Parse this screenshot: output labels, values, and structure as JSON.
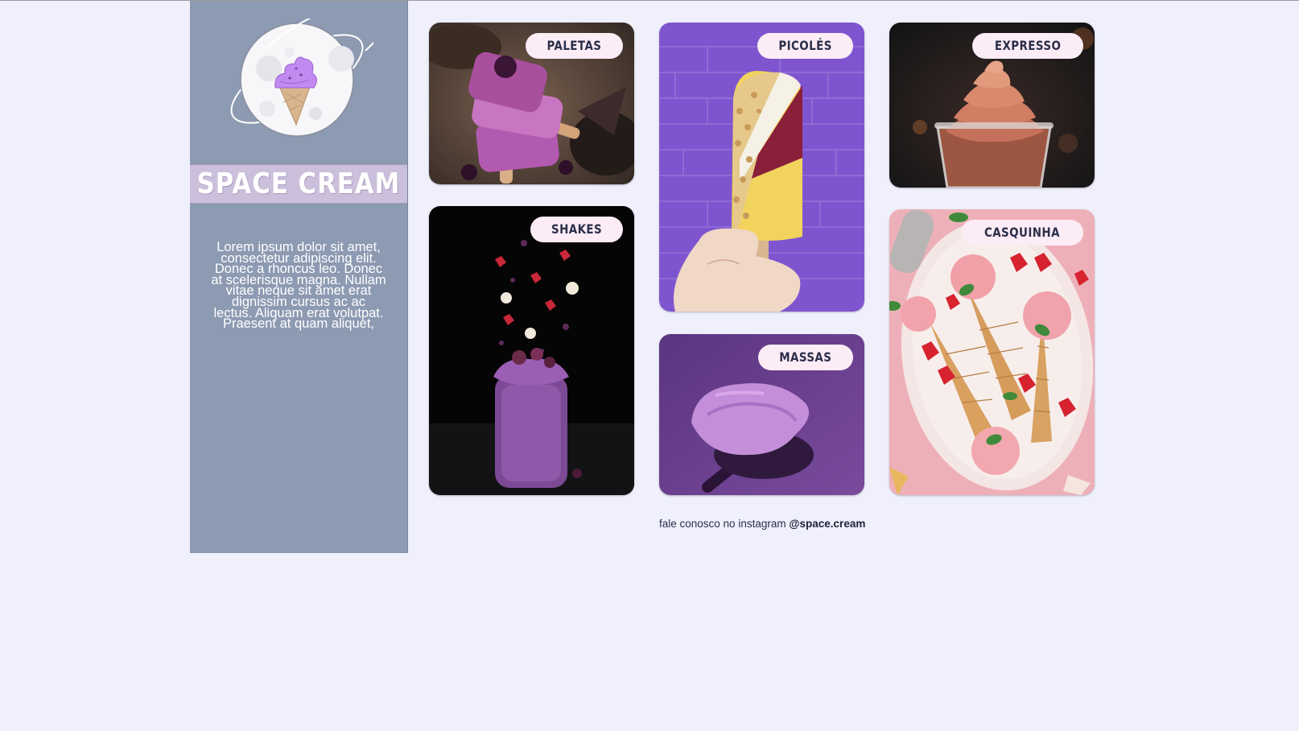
{
  "brand": {
    "name": "SPACE CREAM",
    "description": "Lorem ipsum dolor sit amet, consectetur adipiscing elit. Donec a rhoncus leo. Donec at scelerisque magna. Nullam vitae neque sit amet erat dignissim cursus ac ac lectus. Aliquam erat volutpat. Praesent at quam aliquet,"
  },
  "categories": [
    {
      "label": "PALETAS"
    },
    {
      "label": "PICOLÉS"
    },
    {
      "label": "EXPRESSO"
    },
    {
      "label": "SHAKES"
    },
    {
      "label": "MASSAS"
    },
    {
      "label": "CASQUINHA"
    }
  ],
  "footer": {
    "text": "fale conosco no instagram",
    "handle": "@space.cream"
  },
  "colors": {
    "background": "#eff0fc",
    "sidebar": "#8c9ab2",
    "brand_band": "#cbbfdc",
    "pill": "#fcecf6",
    "pill_text": "#2b2f4a"
  }
}
